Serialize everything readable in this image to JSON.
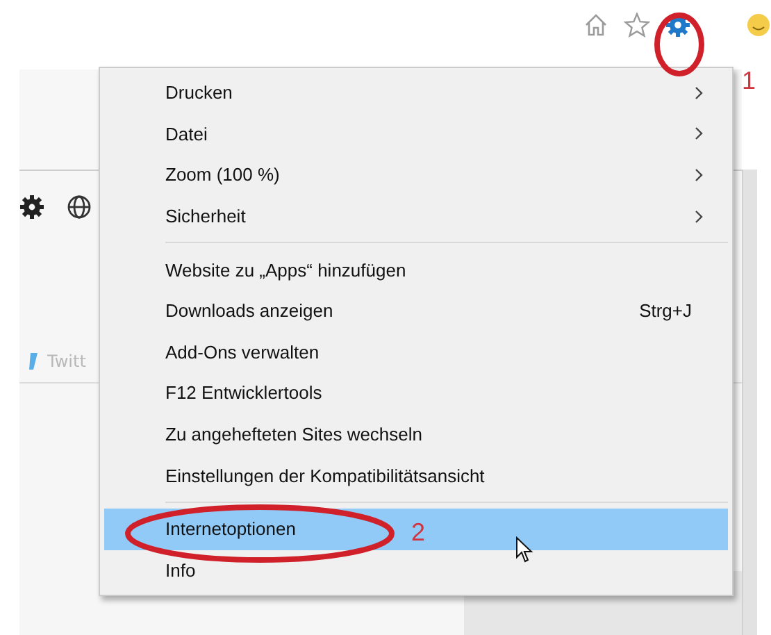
{
  "page": {
    "social_label": "Twitt"
  },
  "menu": {
    "sections": [
      [
        {
          "label": "Drucken",
          "kind": "submenu",
          "selected": false
        },
        {
          "label": "Datei",
          "kind": "submenu",
          "selected": false
        },
        {
          "label": "Zoom (100 %)",
          "kind": "submenu",
          "selected": false
        },
        {
          "label": "Sicherheit",
          "kind": "submenu",
          "selected": false
        }
      ],
      [
        {
          "label": "Website zu „Apps“ hinzufügen",
          "kind": "command",
          "selected": false
        },
        {
          "label": "Downloads anzeigen",
          "kind": "command",
          "shortcut": "Strg+J",
          "selected": false
        },
        {
          "label": "Add-Ons verwalten",
          "kind": "command",
          "selected": false
        },
        {
          "label": "F12 Entwicklertools",
          "kind": "command",
          "selected": false
        },
        {
          "label": "Zu angehefteten Sites wechseln",
          "kind": "command",
          "selected": false
        },
        {
          "label": "Einstellungen der Kompatibilitätsansicht",
          "kind": "command",
          "selected": false
        }
      ],
      [
        {
          "label": "Internetoptionen",
          "kind": "command",
          "selected": true
        },
        {
          "label": "Info",
          "kind": "command",
          "selected": false
        }
      ]
    ]
  },
  "annotations": [
    {
      "label": "1"
    },
    {
      "label": "2"
    }
  ]
}
